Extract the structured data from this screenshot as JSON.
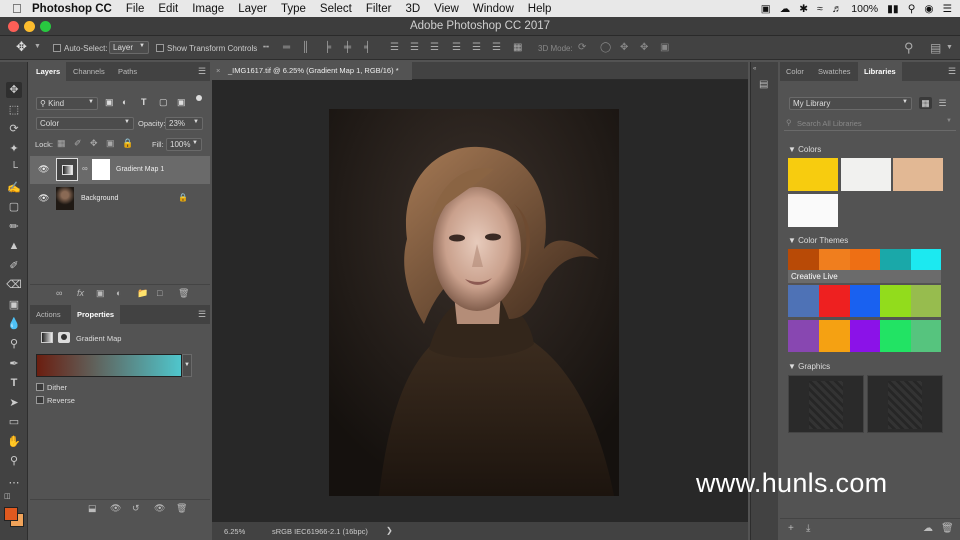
{
  "menubar": {
    "app": "Photoshop CC",
    "items": [
      "File",
      "Edit",
      "Image",
      "Layer",
      "Type",
      "Select",
      "Filter",
      "3D",
      "View",
      "Window",
      "Help"
    ],
    "battery": "100%"
  },
  "window": {
    "title": "Adobe Photoshop CC 2017"
  },
  "options": {
    "auto_select_label": "Auto-Select:",
    "auto_select_value": "Layer",
    "transform_label": "Show Transform Controls",
    "mode_3d": "3D Mode:"
  },
  "layers_panel": {
    "tabs": [
      "Layers",
      "Channels",
      "Paths"
    ],
    "filter_kind": "Kind",
    "blend_mode": "Color",
    "opacity_label": "Opacity:",
    "opacity_value": "23%",
    "lock_label": "Lock:",
    "fill_label": "Fill:",
    "fill_value": "100%",
    "layers": [
      {
        "name": "Gradient Map 1"
      },
      {
        "name": "Background"
      }
    ]
  },
  "properties_panel": {
    "tabs": [
      "Actions",
      "Properties"
    ],
    "title": "Gradient Map",
    "dither": "Dither",
    "reverse": "Reverse",
    "gradient_start": "#6b1e10",
    "gradient_end": "#4fc6cc"
  },
  "document": {
    "tab_title": "_IMG1617.tif @ 6.25% (Gradient Map 1, RGB/16) *",
    "zoom": "6.25%",
    "profile": "sRGB IEC61966-2.1 (16bpc)"
  },
  "libraries_panel": {
    "tabs": [
      "Color",
      "Swatches",
      "Libraries"
    ],
    "library": "My Library",
    "search_placeholder": "Search All Libraries",
    "colors_header": "Colors",
    "colors": [
      "#f7cc0f",
      "#f1f1ef",
      "#e2b894",
      "#fafafa"
    ],
    "themes_header": "Color Themes",
    "theme1": [
      "#b84a06",
      "#f07e1e",
      "#ee6f14",
      "#1aa8a9",
      "#1ce9f0"
    ],
    "theme1_name": "Creative Live",
    "theme2": [
      "#4e72b6",
      "#ee2020",
      "#1961f0",
      "#92dc1c",
      "#97bc4e"
    ],
    "theme3": [
      "#8847b1",
      "#f5a112",
      "#8b12e8",
      "#22e364",
      "#56c47e"
    ],
    "graphics_header": "Graphics"
  },
  "watermark": "www.hunls.com",
  "colors": {
    "foreground": "#e0591f",
    "background": "#f0a35a"
  }
}
